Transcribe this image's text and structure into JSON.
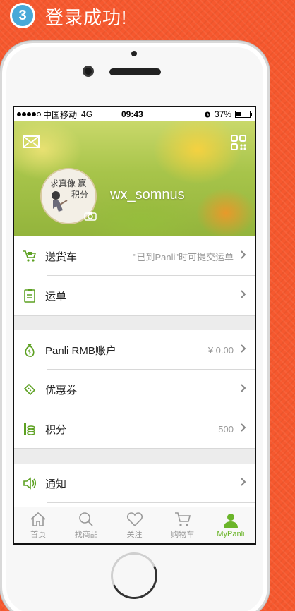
{
  "heading": {
    "step": "3",
    "title": "登录成功!"
  },
  "status_bar": {
    "carrier": "中国移动",
    "network": "4G",
    "time": "09:43",
    "battery": "37%",
    "battery_level": 0.37
  },
  "profile": {
    "username": "wx_somnus",
    "avatar_line1": "求真像",
    "avatar_line2": "赢",
    "avatar_line3": "积分"
  },
  "rows": {
    "delivery": {
      "label": "送货车",
      "value": "\"已到Panli\"时可提交运单"
    },
    "waybill": {
      "label": "运单",
      "value": ""
    },
    "rmb": {
      "label": "Panli RMB账户",
      "value": "¥ 0.00"
    },
    "coupon": {
      "label": "优惠券",
      "value": ""
    },
    "points": {
      "label": "积分",
      "value": "500"
    },
    "notice": {
      "label": "通知",
      "value": ""
    }
  },
  "tabs": [
    {
      "label": "首页",
      "icon": "home-icon"
    },
    {
      "label": "找商品",
      "icon": "search-icon"
    },
    {
      "label": "关注",
      "icon": "heart-icon"
    },
    {
      "label": "购物车",
      "icon": "cart-icon"
    },
    {
      "label": "MyPanli",
      "icon": "user-icon"
    }
  ],
  "colors": {
    "background": "#f6582e",
    "accent": "#6bb52a",
    "badge": "#48a9d8"
  }
}
